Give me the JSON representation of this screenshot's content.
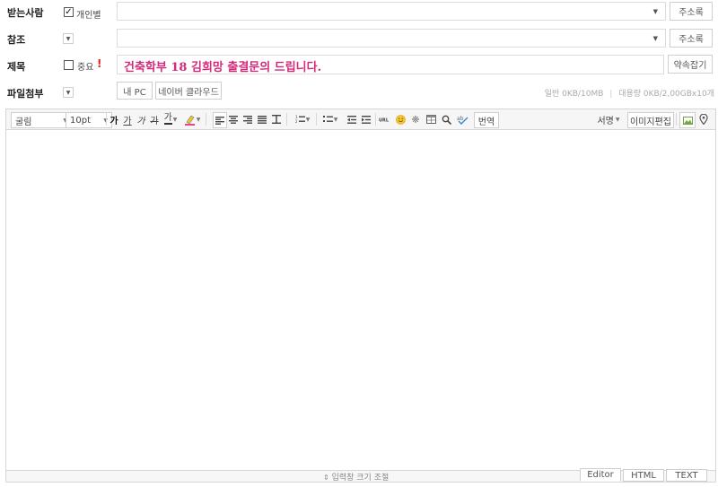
{
  "rows": {
    "recipient": {
      "label": "받는사람",
      "checkbox_label": "개인별",
      "checked": true,
      "addressbook": "주소록"
    },
    "cc": {
      "label": "참조",
      "addressbook": "주소록"
    },
    "subject": {
      "label": "제목",
      "important_label": "중요",
      "important_mark": "!",
      "value": "건축학부 18 김희망 출결문의 드립니다.",
      "shortcut": "약속잡기"
    },
    "attach": {
      "label": "파일첨부",
      "my_pc": "내 PC",
      "cloud": "네이버 클라우드",
      "general": "일반 0KB/10MB",
      "large": "대용량 0KB/2,00GBx10개"
    }
  },
  "toolbar": {
    "font": "굴림",
    "size": "10pt",
    "bold": "가",
    "underline": "가",
    "italic": "가",
    "strike": "가",
    "fontcolor": "가",
    "translate": "번역",
    "signature": "서명",
    "image_edit": "이미지편집"
  },
  "footer": {
    "resize": "입력창 크기 조절",
    "tabs": [
      "Editor",
      "HTML",
      "TEXT"
    ]
  },
  "colors": {
    "subject_text": "#d6297a",
    "important": "#e2231a"
  }
}
